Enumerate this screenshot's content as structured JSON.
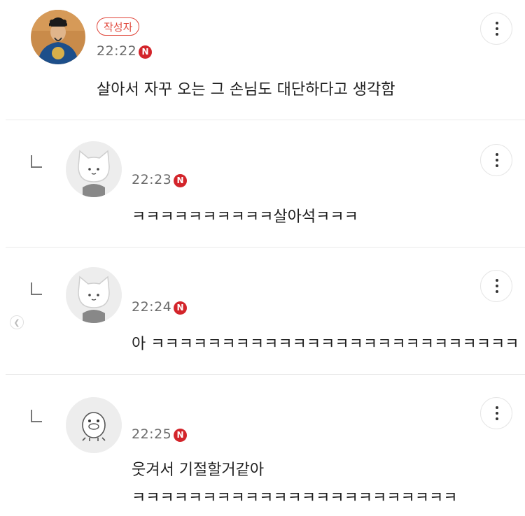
{
  "comments": [
    {
      "author_badge": "작성자",
      "time": "22:22",
      "new_label": "N",
      "text": "살아서 자꾸 오는 그 손님도 대단하다고 생각함",
      "avatar": "king-portrait-avatar"
    },
    {
      "time": "22:23",
      "new_label": "N",
      "text": "ㅋㅋㅋㅋㅋㅋㅋㅋㅋㅋ살아석ㅋㅋㅋ",
      "avatar": "gray-cat-avatar"
    },
    {
      "time": "22:24",
      "new_label": "N",
      "text": "아 ㅋㅋㅋㅋㅋㅋㅋㅋㅋㅋㅋㅋㅋㅋㅋㅋㅋㅋㅋㅋㅋㅋㅋㅋㅋㅋ",
      "avatar": "gray-cat-avatar"
    },
    {
      "time": "22:25",
      "new_label": "N",
      "text_line1": "웃겨서 기절할거같아",
      "text_line2": "ㅋㅋㅋㅋㅋㅋㅋㅋㅋㅋㅋㅋㅋㅋㅋㅋㅋㅋㅋㅋㅋㅋㅋ",
      "avatar": "duck-character-avatar"
    }
  ],
  "icons": {
    "more": "more-vertical-icon",
    "reply": "reply-indent-icon",
    "prev": "chevron-left-icon"
  },
  "colors": {
    "accent": "#e0463a",
    "new_badge": "#d3242a",
    "divider": "#e9e9e9"
  }
}
